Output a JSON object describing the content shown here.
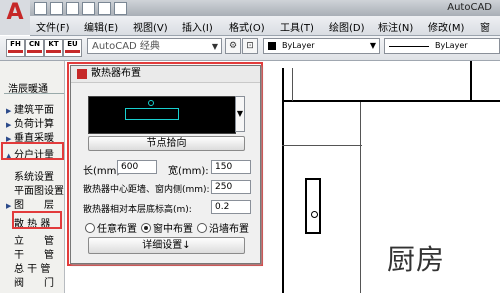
{
  "app": {
    "title": "AutoCAD",
    "logo_letter": "A"
  },
  "menus": [
    "文件(F)",
    "编辑(E)",
    "视图(V)",
    "插入(I)",
    "格式(O)",
    "工具(T)",
    "绘图(D)",
    "标注(N)",
    "修改(M)",
    "窗"
  ],
  "toolbar": {
    "logos": [
      {
        "label": "FH"
      },
      {
        "label": "CN"
      },
      {
        "label": "KT"
      },
      {
        "label": "EU"
      }
    ],
    "workspace": "AutoCAD 经典",
    "layer": "ByLayer",
    "linetype": "ByLayer"
  },
  "sidebar": {
    "header": "浩辰暖通",
    "items": [
      {
        "label": "建筑平面",
        "marker": "▶"
      },
      {
        "label": "负荷计算",
        "marker": "▶"
      },
      {
        "label": "垂直采暖",
        "marker": "▶"
      },
      {
        "label": "分户计量",
        "marker": "▲"
      },
      {
        "label": "系统设置",
        "marker": ""
      },
      {
        "label": "平面图设置",
        "marker": ""
      },
      {
        "label": "图　　层",
        "marker": "▶"
      },
      {
        "label": "散 热 器",
        "marker": ""
      },
      {
        "label": "立　　管",
        "marker": ""
      },
      {
        "label": "干　　管",
        "marker": ""
      },
      {
        "label": "总 干 管",
        "marker": ""
      },
      {
        "label": "阀　　门",
        "marker": ""
      }
    ]
  },
  "dialog": {
    "title": "散热器布置",
    "node_switch": "节点拾向",
    "length_label": "长(mm):",
    "length_value": "600",
    "width_label": "宽(mm):",
    "width_value": "150",
    "center_dist_label": "散热器中心距墙、窗内侧(mm):",
    "center_dist_value": "250",
    "bottom_height_label": "散热器相对本层底标高(m):",
    "bottom_height_value": "0.2",
    "radios": [
      {
        "label": "任意布置",
        "selected": false
      },
      {
        "label": "窗中布置",
        "selected": true
      },
      {
        "label": "沿墙布置",
        "selected": false
      }
    ],
    "detail_button": "详细设置↓"
  },
  "canvas": {
    "room_label": "厨房"
  },
  "colors": {
    "highlight": "#e23b3b",
    "preview_line": "#19d0d0",
    "accent": "#c62828"
  }
}
